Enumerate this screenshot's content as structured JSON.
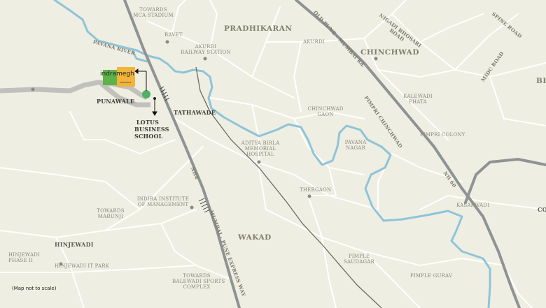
{
  "map": {
    "project": {
      "name": "indramegh",
      "sub_label": "PUNAWALE"
    },
    "areas": {
      "pradhikaran": "PRADHIKARAN",
      "chinchwad": "CHINCHWAD",
      "wakad": "WAKAD",
      "bhosari_partial": "BH",
      "co_partial": "CO"
    },
    "places": {
      "punawale": "PUNAWALE",
      "tathawade": "TATHAWADE",
      "lotus_school": [
        "LOTUS",
        "BUSINESS",
        "SCHOOL"
      ],
      "hinjewadi": "HINJEWADI"
    },
    "labels": {
      "mca": [
        "TOWARDS",
        "MCA STADIUM"
      ],
      "ravet": "RAVET",
      "akurdi_station": [
        "AKURDI",
        "RAILWAY STATION"
      ],
      "akurdi": "AKURDI",
      "chinchwad_gaon": [
        "CHINCHWAD",
        "GAON"
      ],
      "kalewadi_phata": [
        "KALEWADI",
        "PHATA"
      ],
      "pimpri_colony": "PIMPRI COLONY",
      "aditya_birla": [
        "ADITYA BIRLA",
        "MEMORIAL",
        "HOSPITAL"
      ],
      "pavana_nagar": [
        "PAVANA",
        "NAGAR"
      ],
      "thergaon": "THERGAON",
      "kasarwadi": "KASARWADI",
      "indira": [
        "INDIRA INSTITUTE",
        "OF MANAGEMENT"
      ],
      "marunji": [
        "TOWARDS",
        "MARUNJI"
      ],
      "hinjewadi_phase": [
        "HINJEWADI",
        "PHASE II"
      ],
      "hinjewadi_it": "HINJEWADI IT PARK",
      "pimple_saudagar": [
        "PIMPLE",
        "SAUDAGAR"
      ],
      "pimple_gurav": "PIMPLE GURAV",
      "balewadi": [
        "TOWARDS",
        "BALEWADI SPORTS",
        "COMPLEX"
      ]
    },
    "roads": {
      "pavana_river": "PAVANA RIVER",
      "old_pune_mumbai": "OLD PUNE - MUMBAI Rd.",
      "nigadi_bhosari": [
        "NIGADI BHOSARI",
        "ROAD"
      ],
      "spine_road": "SPINE ROAD",
      "midc_road": "MIDC ROAD",
      "pimpri_chinchwad": "PIMPRI CHINCHWAD",
      "nh4": "NH4",
      "nh60": "NH 60",
      "expressway": "MUMBAI - PUNE EXPRESS WAY"
    },
    "note": "(Map not to scale)",
    "colors": {
      "river": "#8fc4d8",
      "highway": "#8f9394",
      "road": "#c3c4c0",
      "background": "#efeee2"
    }
  }
}
